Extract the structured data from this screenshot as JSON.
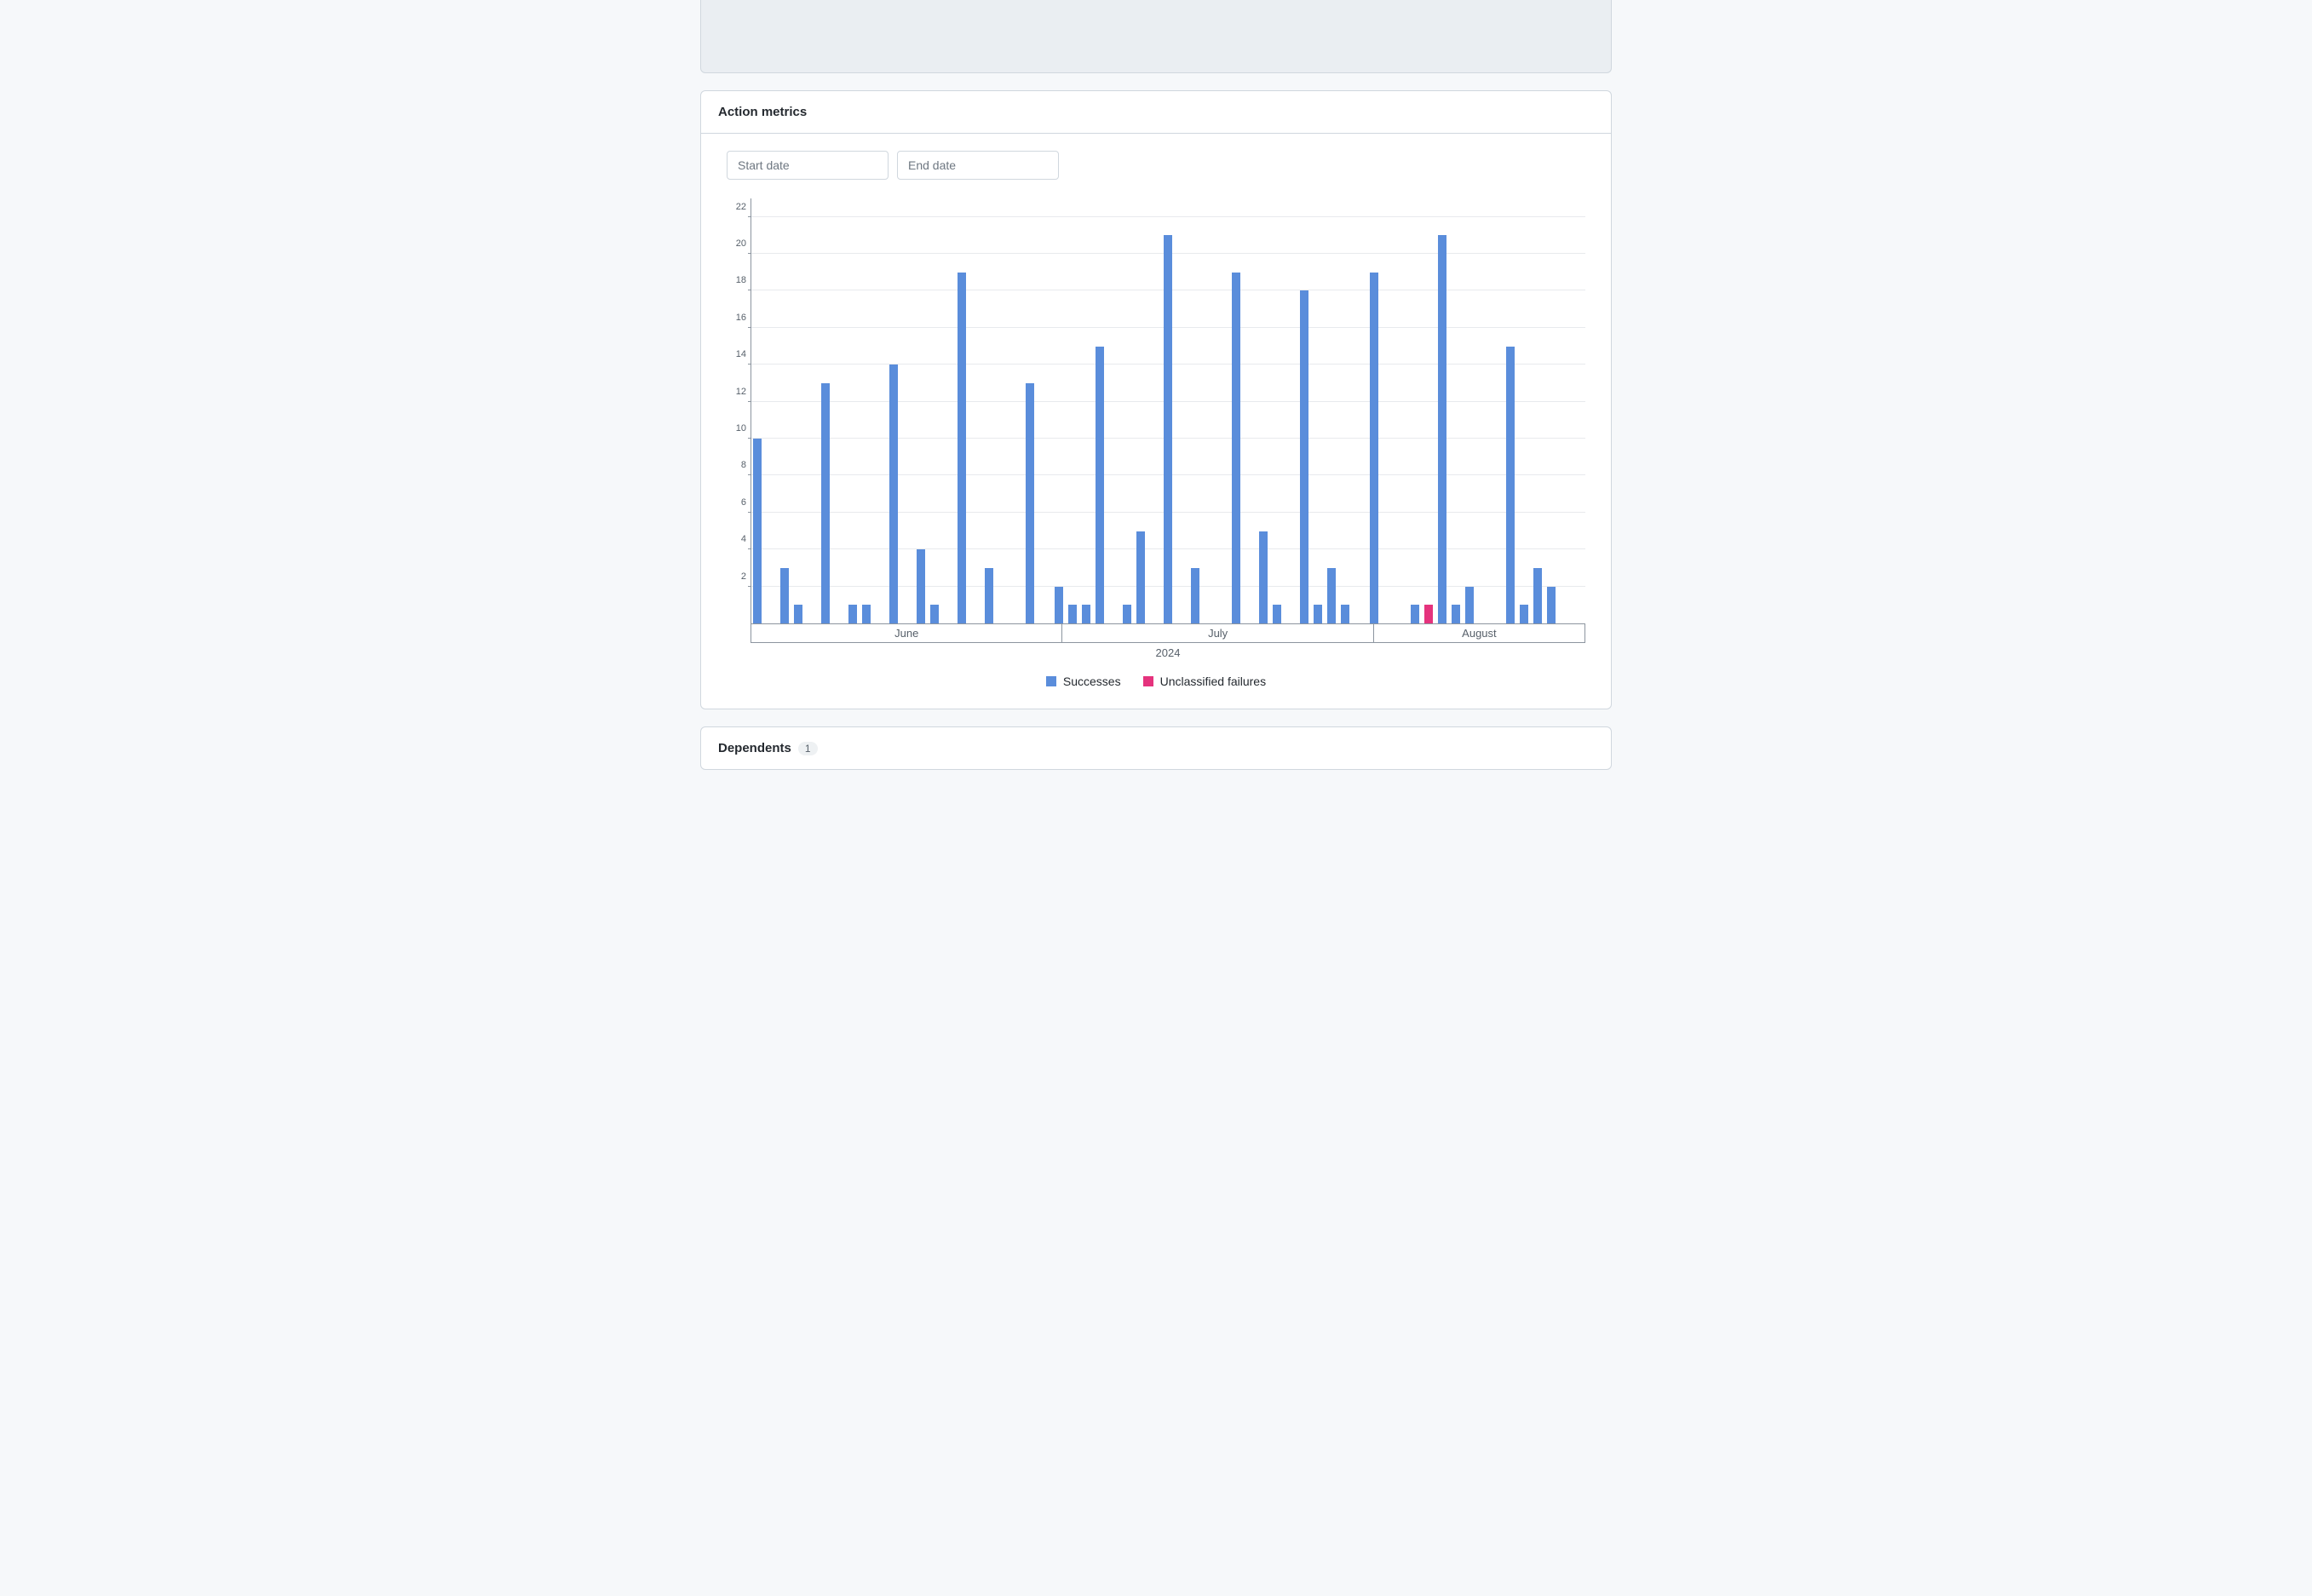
{
  "placeholder_card": {},
  "action_metrics": {
    "title": "Action metrics",
    "start_placeholder": "Start date",
    "end_placeholder": "End date"
  },
  "chart_data": {
    "type": "bar",
    "title": "Action metrics",
    "xlabel": "",
    "ylabel": "",
    "ylim": [
      0,
      23
    ],
    "yticks": [
      2,
      4,
      6,
      8,
      10,
      12,
      14,
      16,
      18,
      20,
      22
    ],
    "year_label": "2024",
    "months": [
      {
        "label": "June",
        "span_days": 22
      },
      {
        "label": "July",
        "span_days": 22
      },
      {
        "label": "August",
        "span_days": 15
      }
    ],
    "series": [
      {
        "name": "Successes",
        "color": "#5a8ddb"
      },
      {
        "name": "Unclassified failures",
        "color": "#e5337d"
      }
    ],
    "data": [
      {
        "month": "June",
        "successes": 10,
        "failures": 0
      },
      {
        "month": "June",
        "successes": 0,
        "failures": 0
      },
      {
        "month": "June",
        "successes": 3,
        "failures": 0
      },
      {
        "month": "June",
        "successes": 1,
        "failures": 0
      },
      {
        "month": "June",
        "successes": 0,
        "failures": 0
      },
      {
        "month": "June",
        "successes": 13,
        "failures": 0
      },
      {
        "month": "June",
        "successes": 0,
        "failures": 0
      },
      {
        "month": "June",
        "successes": 1,
        "failures": 0
      },
      {
        "month": "June",
        "successes": 1,
        "failures": 0
      },
      {
        "month": "June",
        "successes": 0,
        "failures": 0
      },
      {
        "month": "June",
        "successes": 14,
        "failures": 0
      },
      {
        "month": "June",
        "successes": 0,
        "failures": 0
      },
      {
        "month": "June",
        "successes": 4,
        "failures": 0
      },
      {
        "month": "June",
        "successes": 1,
        "failures": 0
      },
      {
        "month": "June",
        "successes": 0,
        "failures": 0
      },
      {
        "month": "June",
        "successes": 19,
        "failures": 0
      },
      {
        "month": "June",
        "successes": 0,
        "failures": 0
      },
      {
        "month": "June",
        "successes": 3,
        "failures": 0
      },
      {
        "month": "June",
        "successes": 0,
        "failures": 0
      },
      {
        "month": "June",
        "successes": 0,
        "failures": 0
      },
      {
        "month": "June",
        "successes": 13,
        "failures": 0
      },
      {
        "month": "June",
        "successes": 0,
        "failures": 0
      },
      {
        "month": "July",
        "successes": 2,
        "failures": 0
      },
      {
        "month": "July",
        "successes": 1,
        "failures": 0
      },
      {
        "month": "July",
        "successes": 1,
        "failures": 0
      },
      {
        "month": "July",
        "successes": 15,
        "failures": 0
      },
      {
        "month": "July",
        "successes": 0,
        "failures": 0
      },
      {
        "month": "July",
        "successes": 1,
        "failures": 0
      },
      {
        "month": "July",
        "successes": 5,
        "failures": 0
      },
      {
        "month": "July",
        "successes": 0,
        "failures": 0
      },
      {
        "month": "July",
        "successes": 21,
        "failures": 0
      },
      {
        "month": "July",
        "successes": 0,
        "failures": 0
      },
      {
        "month": "July",
        "successes": 3,
        "failures": 0
      },
      {
        "month": "July",
        "successes": 0,
        "failures": 0
      },
      {
        "month": "July",
        "successes": 0,
        "failures": 0
      },
      {
        "month": "July",
        "successes": 19,
        "failures": 0
      },
      {
        "month": "July",
        "successes": 0,
        "failures": 0
      },
      {
        "month": "July",
        "successes": 5,
        "failures": 0
      },
      {
        "month": "July",
        "successes": 1,
        "failures": 0
      },
      {
        "month": "July",
        "successes": 0,
        "failures": 0
      },
      {
        "month": "July",
        "successes": 18,
        "failures": 0
      },
      {
        "month": "July",
        "successes": 1,
        "failures": 0
      },
      {
        "month": "July",
        "successes": 3,
        "failures": 0
      },
      {
        "month": "July",
        "successes": 1,
        "failures": 0
      },
      {
        "month": "August",
        "successes": 0,
        "failures": 0
      },
      {
        "month": "August",
        "successes": 19,
        "failures": 0
      },
      {
        "month": "August",
        "successes": 0,
        "failures": 0
      },
      {
        "month": "August",
        "successes": 0,
        "failures": 0
      },
      {
        "month": "August",
        "successes": 1,
        "failures": 0
      },
      {
        "month": "August",
        "successes": 0,
        "failures": 1
      },
      {
        "month": "August",
        "successes": 21,
        "failures": 0
      },
      {
        "month": "August",
        "successes": 1,
        "failures": 0
      },
      {
        "month": "August",
        "successes": 2,
        "failures": 0
      },
      {
        "month": "August",
        "successes": 0,
        "failures": 0
      },
      {
        "month": "August",
        "successes": 0,
        "failures": 0
      },
      {
        "month": "August",
        "successes": 15,
        "failures": 0
      },
      {
        "month": "August",
        "successes": 1,
        "failures": 0
      },
      {
        "month": "August",
        "successes": 3,
        "failures": 0
      },
      {
        "month": "August",
        "successes": 2,
        "failures": 0
      }
    ],
    "legend": {
      "successes": "Successes",
      "failures": "Unclassified failures"
    }
  },
  "dependents": {
    "title": "Dependents",
    "count": "1"
  }
}
